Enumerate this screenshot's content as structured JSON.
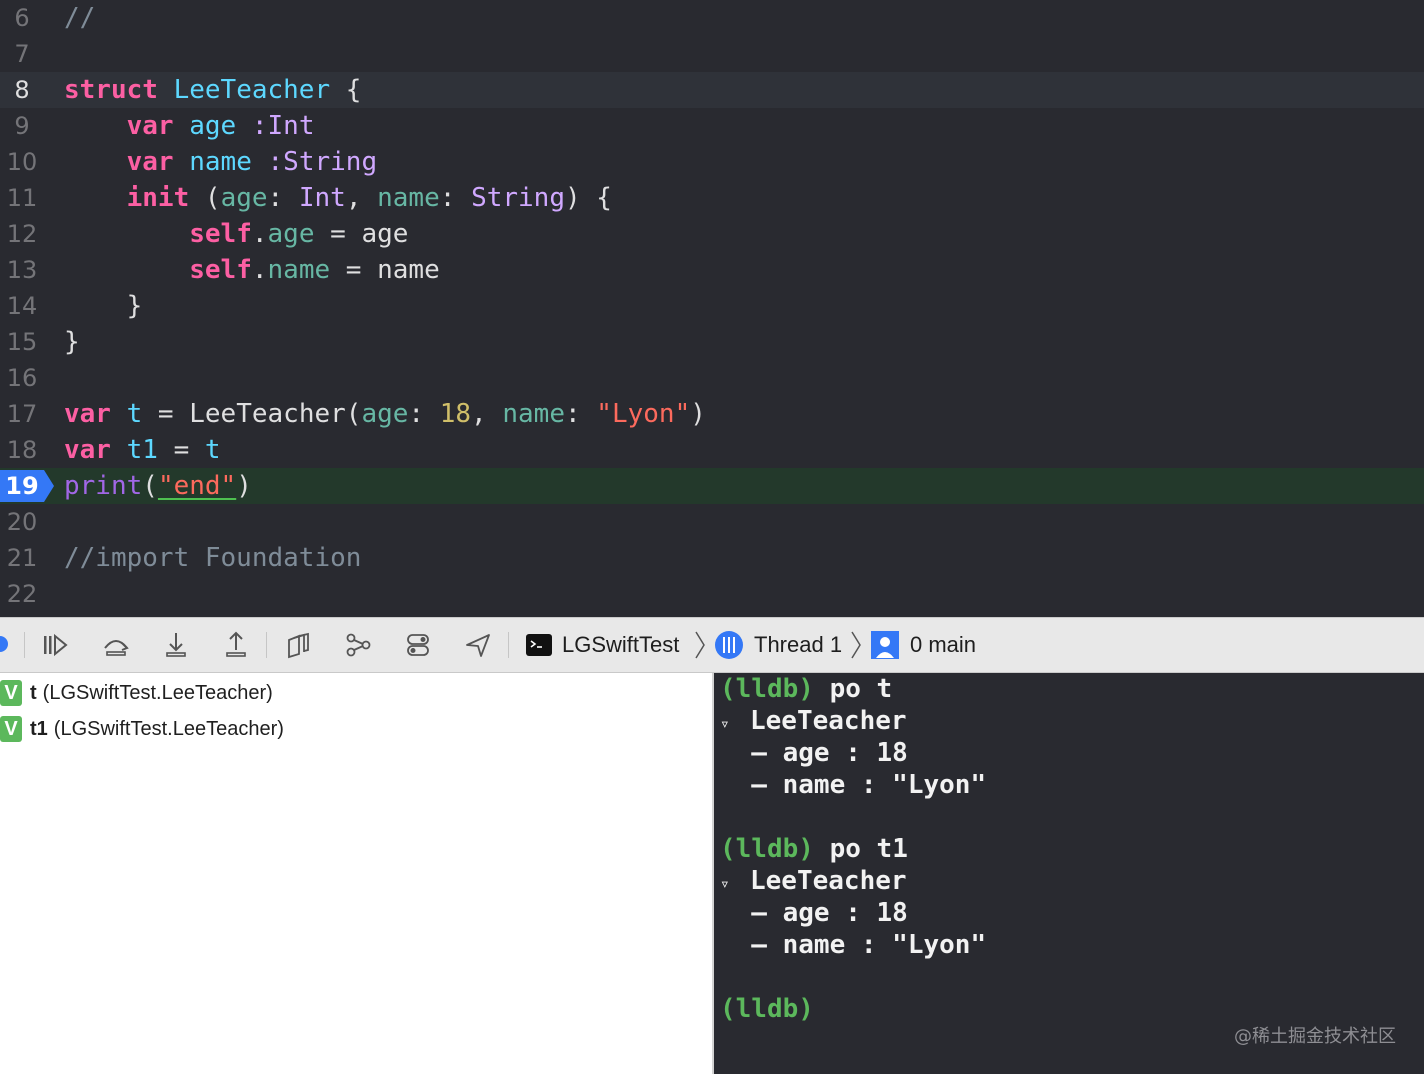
{
  "editor": {
    "lines": [
      {
        "n": "6"
      },
      {
        "n": "7"
      },
      {
        "n": "8"
      },
      {
        "n": "9"
      },
      {
        "n": "10"
      },
      {
        "n": "11"
      },
      {
        "n": "12"
      },
      {
        "n": "13"
      },
      {
        "n": "14"
      },
      {
        "n": "15"
      },
      {
        "n": "16"
      },
      {
        "n": "17"
      },
      {
        "n": "18"
      },
      {
        "n": "19"
      },
      {
        "n": "20"
      },
      {
        "n": "21"
      },
      {
        "n": "22"
      }
    ],
    "tokens": {
      "l6_comment": "//",
      "kw_struct": "struct",
      "type_name": "LeeTeacher",
      "brace_open": " {",
      "kw_var": "var",
      "prop_age": "age",
      "prop_name": "name",
      "type_int": ":Int",
      "type_string": ":String",
      "kw_init": "init",
      "init_open": " (",
      "param_age": "age",
      "colon": ":",
      "t_int": "Int",
      "comma": ",",
      "param_name": "name",
      "t_string": "String",
      "init_close": ") {",
      "kw_self": "self",
      "dot": ".",
      "assign": " = ",
      "val_age": "age",
      "val_name": "name",
      "close_brace": "}",
      "var_t": "t",
      "var_t1": "t1",
      "ctor": "LeeTeacher",
      "paren_open": "(",
      "paren_close": ")",
      "num_18": "18",
      "str_lyon": "\"Lyon\"",
      "fn_print": "print",
      "str_end": "\"end\"",
      "l21_comment": "//import Foundation"
    },
    "current_line": "8",
    "pc_line": "19"
  },
  "debugbar": {
    "scheme": "LGSwiftTest",
    "thread": "Thread 1",
    "frame": "0 main",
    "icons": [
      "breakpoints-toggle-icon",
      "continue-icon",
      "step-over-icon",
      "step-into-icon",
      "step-out-icon",
      "view-hierarchy-icon",
      "memory-graph-icon",
      "environment-overrides-icon",
      "simulate-location-icon",
      "terminal-icon",
      "thread-icon",
      "frame-icon"
    ]
  },
  "variables": [
    {
      "badge": "V",
      "name": "t",
      "type": "(LGSwiftTest.LeeTeacher)"
    },
    {
      "badge": "V",
      "name": "t1",
      "type": "(LGSwiftTest.LeeTeacher)"
    }
  ],
  "console": {
    "prompt": "(lldb)",
    "cmd1": " po t",
    "cmd2": " po t1",
    "struct_name": "LeeTeacher",
    "triangle": "▿",
    "field_age": "  – age : 18",
    "field_name": "  – name : \"Lyon\""
  },
  "watermark": "@稀土掘金技术社区",
  "colors": {
    "editor_bg": "#292a30",
    "keyword": "#fc5fa3",
    "type": "#5dd8ff",
    "property": "#67b7a4",
    "string": "#fc6a5d",
    "number": "#d0bf69",
    "comment": "#7f8c98",
    "pc_marker": "#3478f6",
    "lldb_prompt": "#5cb85c"
  }
}
